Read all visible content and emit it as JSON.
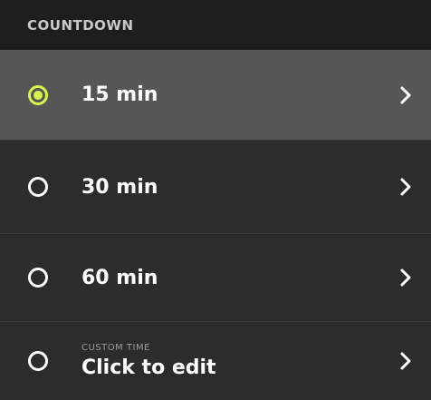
{
  "header": {
    "title": "COUNTDOWN"
  },
  "options": [
    {
      "label": "15 min",
      "selected": true
    },
    {
      "label": "30 min",
      "selected": false
    },
    {
      "label": "60 min",
      "selected": false
    }
  ],
  "custom": {
    "sublabel": "CUSTOM TIME",
    "label": "Click to edit",
    "selected": false
  },
  "colors": {
    "accent": "#d9f34a",
    "header_bg": "#1e1e1e",
    "row_bg": "#2c2c2c",
    "selected_bg": "#565656"
  },
  "icons": {
    "chevron": "chevron-right-icon",
    "radio": "radio-icon"
  }
}
